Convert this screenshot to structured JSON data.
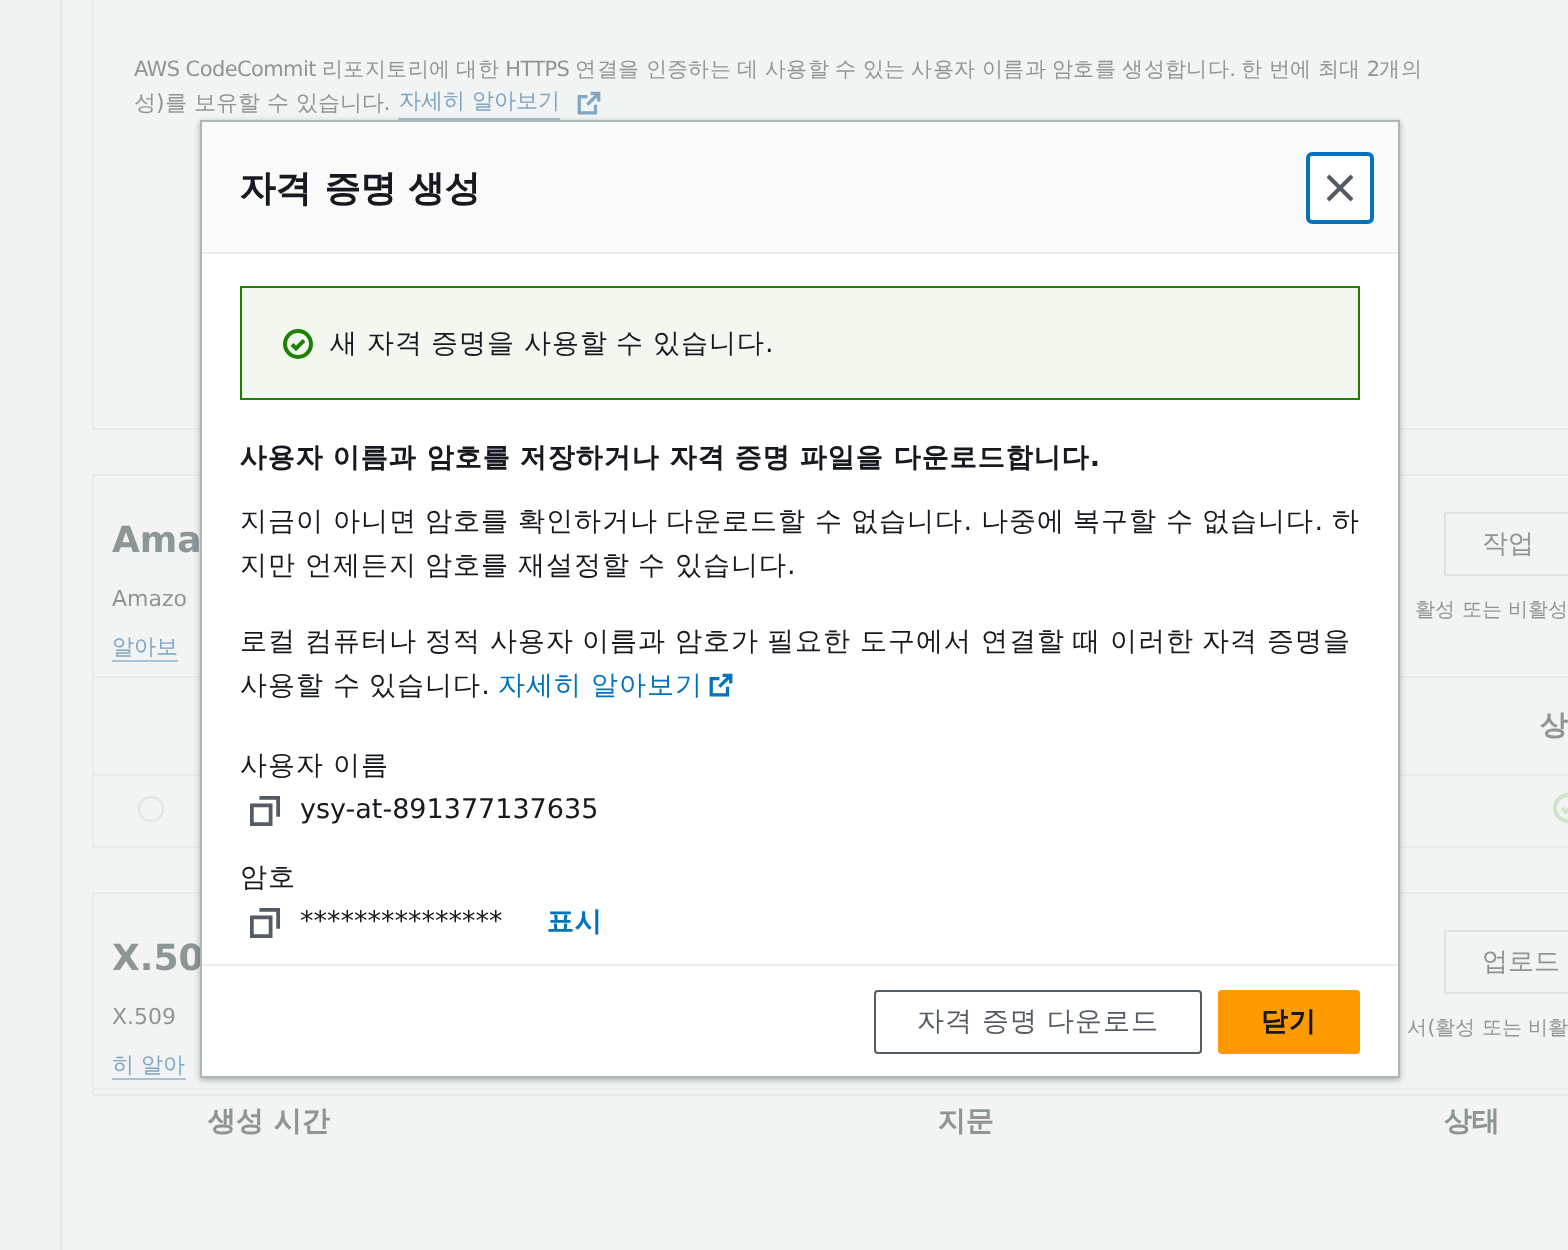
{
  "background": {
    "intro": {
      "line_1": "AWS CodeCommit 리포지토리에 대한 HTTPS 연결을 인증하는 데 사용할 수 있는 사용자 이름과 암호를 생성합니다. 한 번에 최대 2개의",
      "line_2": "성)를 보유할 수 있습니다.",
      "link": "자세히 알아보기"
    },
    "sections": [
      {
        "title": "Ama",
        "description": "Amazo",
        "link": "알아보",
        "action": "작업",
        "note": "활성 또는 비활성",
        "column": "상",
        "row": {
          "selected": false
        }
      },
      {
        "title": "X.50",
        "description": "X.509",
        "link": "히 알아",
        "action": "업로드",
        "note": "서(활성 또는 비활"
      }
    ],
    "table_columns": [
      "생성 시간",
      "지문",
      "상태"
    ]
  },
  "dialog": {
    "title": "자격 증명 생성",
    "alert": "새 자격 증명을 사용할 수 있습니다.",
    "heading": "사용자 이름과 암호를 저장하거나 자격 증명 파일을 다운로드합니다.",
    "paragraph": "지금이 아니면 암호를 확인하거나 다운로드할 수 없습니다. 나중에 복구할 수 없습니다. 하지만 언제든지 암호를 재설정할 수 있습니다.",
    "note": "로컬 컴퓨터나 정적 사용자 이름과 암호가 필요한 도구에서 연결할 때 이러한 자격 증명을 사용할 수 있습니다.",
    "note_link": "자세히 알아보기",
    "fields": [
      {
        "label": "사용자 이름",
        "value": "ysy-at-891377137635"
      },
      {
        "label": "암호",
        "value": "***************",
        "action": "표시"
      }
    ],
    "buttons": [
      {
        "label": "자격 증명 다운로드",
        "kind": "secondary"
      },
      {
        "label": "닫기",
        "kind": "primary"
      }
    ]
  }
}
